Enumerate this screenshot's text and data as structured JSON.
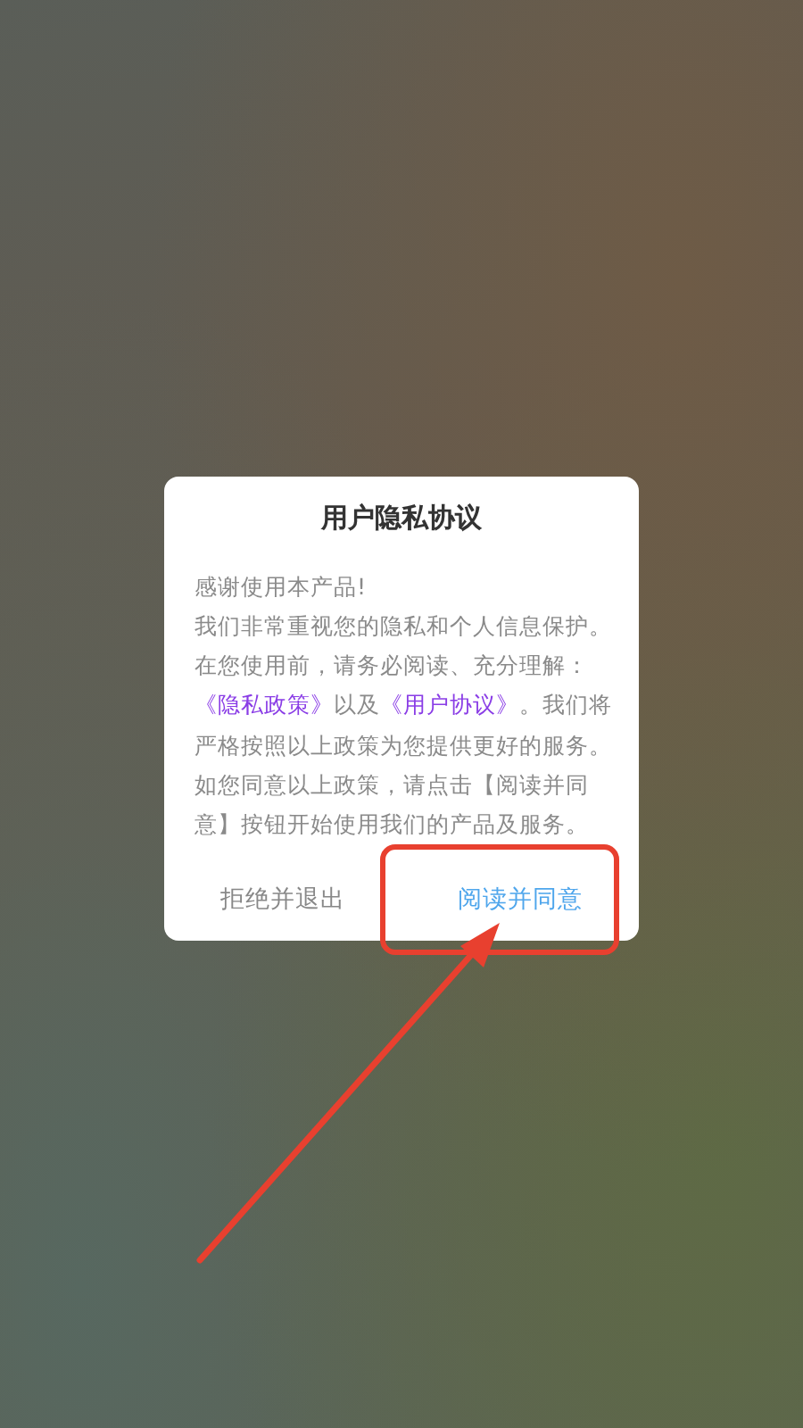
{
  "dialog": {
    "title": "用户隐私协议",
    "body": [
      {
        "kind": "text",
        "text": "感谢使用本产品!"
      },
      {
        "kind": "break"
      },
      {
        "kind": "text",
        "text": "我们非常重视您的隐私和个人信息保护。在您使用前，请务必阅读、充分理解："
      },
      {
        "kind": "link",
        "text": "《隐私政策》"
      },
      {
        "kind": "text",
        "text": "以及"
      },
      {
        "kind": "link",
        "text": "《用户协议》"
      },
      {
        "kind": "text",
        "text": "。我们将严格按照以上政策为您提供更好的服务。如您同意以上政策，请点击【阅读并同意】按钮开始使用我们的产品及服务。"
      }
    ],
    "buttons": [
      {
        "kind": "secondary",
        "label": "拒绝并退出"
      },
      {
        "kind": "primary",
        "label": "阅读并同意"
      }
    ]
  }
}
